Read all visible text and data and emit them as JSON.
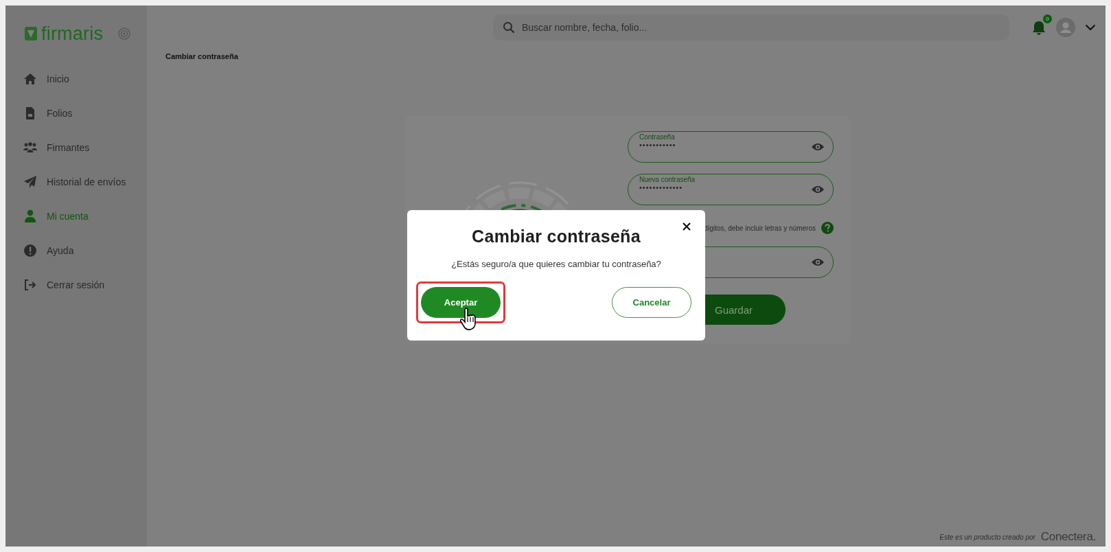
{
  "sidebar": {
    "logo": "firmaris",
    "items": [
      {
        "label": "Inicio",
        "selected": false
      },
      {
        "label": "Folios",
        "selected": false
      },
      {
        "label": "Firmantes",
        "selected": false
      },
      {
        "label": "Historial de envíos",
        "selected": false
      },
      {
        "label": "Mi cuenta",
        "selected": true
      },
      {
        "label": "Ayuda",
        "selected": false
      },
      {
        "label": "Cerrar sesión",
        "selected": false
      }
    ]
  },
  "topbar": {
    "search": {
      "placeholder": "Buscar nombre, fecha, folio..."
    },
    "notifications": {
      "count": "0"
    }
  },
  "breadcrumb": "Cambiar contraseña",
  "form": {
    "fields": [
      {
        "label": "Contraseña",
        "value": "•••••••••••",
        "masked": true
      },
      {
        "label": "Nueva contraseña",
        "value": "•••••••••••••",
        "masked": true
      },
      {
        "masked": true
      }
    ],
    "hint": "dígitos, debe incluir letras y números",
    "save_button": "Guardar"
  },
  "dialog": {
    "title": "Cambiar contraseña",
    "message": "¿Estás seguro/a que quieres cambiar tu contraseña?",
    "buttons": [
      {
        "label": "Aceptar",
        "kind": "primary",
        "highlighted": true
      },
      {
        "label": "Cancelar",
        "kind": "secondary",
        "highlighted": false
      }
    ]
  },
  "footer": {
    "text": "Este es un producto creado por",
    "brand": "Conectera."
  }
}
